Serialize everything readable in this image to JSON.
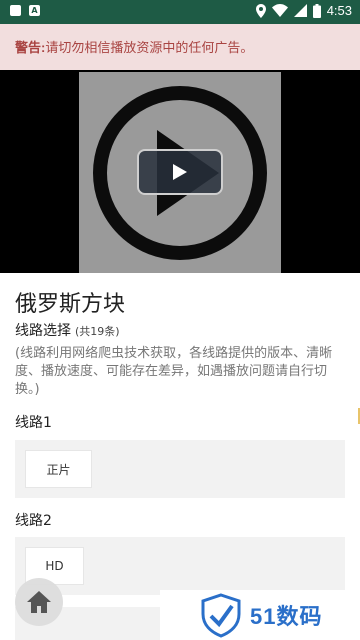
{
  "status_bar": {
    "time": "4:53",
    "left_icons": [
      "notification-app-icon",
      "notification-a-icon"
    ],
    "right_icons": [
      "location-icon",
      "wifi-icon",
      "signal-icon",
      "battery-icon"
    ]
  },
  "warning": {
    "label": "警告:",
    "text": "请切勿相信播放资源中的任何广告。"
  },
  "video": {
    "play_icon": "play-icon"
  },
  "title": "俄罗斯方块",
  "route_select": {
    "label": "线路选择",
    "count": "(共19条)"
  },
  "note": "(线路利用网络爬虫技术获取，各线路提供的版本、清晰度、播放速度、可能存在差异，如遇播放问题请自行切换。)",
  "groups": [
    {
      "label": "线路1",
      "episodes": [
        "正片"
      ]
    },
    {
      "label": "线路2",
      "episodes": [
        "HD"
      ]
    }
  ],
  "home_button": {
    "icon": "home-icon"
  },
  "watermark": {
    "text": "51数码",
    "icon": "shield-logo-icon"
  },
  "colors": {
    "status_bar": "#1e5b45",
    "warning_bg": "#f2dede",
    "warning_text": "#a94442",
    "watermark_blue": "#2a6fc9"
  }
}
